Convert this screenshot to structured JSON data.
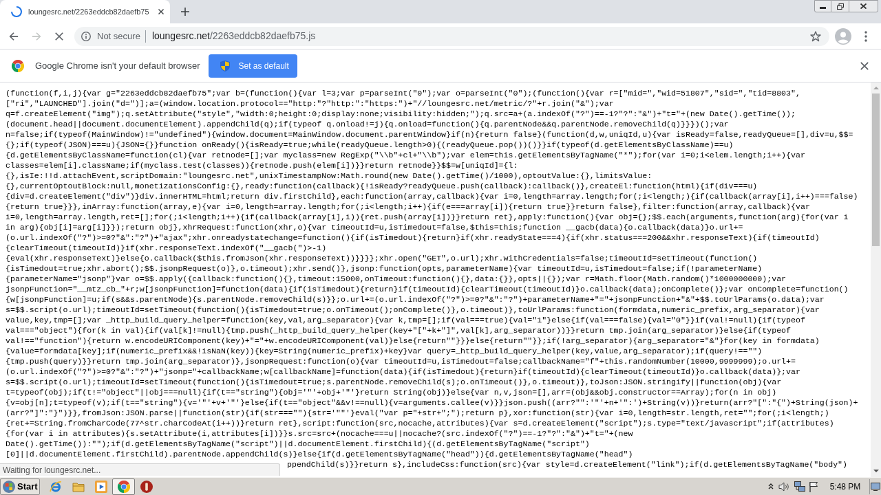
{
  "tabs": [
    {
      "title": "loungesrc.net/2263eddcb82daefb75",
      "selected": true,
      "loading": true
    }
  ],
  "toolbar": {
    "nav": [
      {
        "kind": "back",
        "disabled": false
      },
      {
        "kind": "forward",
        "disabled": true
      },
      {
        "kind": "stop",
        "disabled": false
      }
    ],
    "security_label": "Not secure",
    "url": {
      "host": "loungesrc.net",
      "path": "/2263eddcb82daefb75.js"
    }
  },
  "infobar": {
    "message": "Google Chrome isn't your default browser",
    "button_label": "Set as default"
  },
  "code": {
    "lines": [
      "(function(f,i,j){var g=\"2263eddcb82daefb75\";var b=(function(){var l=3;var p=parseInt(\"0\");var o=parseInt(\"0\");(function(){var r=[\"mid=\",\"wid=51807\",\"sid=\",\"tid=8803\",",
      "[\"ri\",\"LAUNCHED\"].join(\"d=\")];a=(window.location.protocol==\"http:\"?\"http:\":\"https:\")+\"//loungesrc.net/metric/?\"+r.join(\"&\");var",
      "q=f.createElement(\"img\");q.setAttribute(\"style\",\"width:0;height:0;display:none;visibility:hidden;\");q.src=a+(a.indexOf(\"?\")==-1?\"?\":\"&\")+\"t=\"+(new Date().getTime());",
      "(document.head||document.documentElement).appendChild(q);if(typeof q.onload!=j){q.onload=function(){q.parentNode&&q.parentNode.removeChild(q)}}})();var",
      "n=false;if(typeof(MainWindow)!=\"undefined\"){window.document=MainWindow.document.parentWindow}if(n){return false}(function(d,w,uniqId,u){var isReady=false,readyQueue=[],div=u,$$=",
      "{};if(typeof(JSON)===u){JSON={}}function onReady(){isReady=true;while(readyQueue.length>0){(readyQueue.pop())()}}if(typeof(d.getElementsByClassName)==u)",
      "{d.getElementsByClassName=function(cl){var retnode=[];var myclass=new RegExp(\"\\\\b\"+cl+\"\\\\b\");var elem=this.getElementsByTagName(\"*\");for(var i=0;i<elem.length;i++){var",
      "classes=elem[i].className;if(myclass.test(classes)){retnode.push(elem[i])}}return retnode}}$$=w[uniqId]={l:",
      "{},isIe:!!d.attachEvent,scriptDomain:\"loungesrc.net\",unixTimestampNow:Math.round(new Date().getTime()/1000),optoutValue:{},limitsValue:",
      "{},currentOptoutBlock:null,monetizationsConfig:{},ready:function(callback){!isReady?readyQueue.push(callback):callback()},createEl:function(html){if(div===u)",
      "{div=d.createElement(\"div\")}div.innerHTML=html;return div.firstChild},each:function(array,callback){var i=0,length=array.length;for(;i<length;){if(callback(array[i],i++)===false)",
      "{return true}}},inArray:function(array,e){var i=0,length=array.length;for(;i<length;i++){if(e===array[i]){return true}}return false},filter:function(array,callback){var",
      "i=0,length=array.length,ret=[];for(;i<length;i++){if(callback(array[i],i)){ret.push(array[i])}}return ret},apply:function(){var obj={};$$.each(arguments,function(arg){for(var i",
      "in arg){obj[i]=arg[i]}});return obj},xhrRequest:function(xhr,o){var timeoutId=u,isTimedout=false,$this=this;function __gacb(data){o.callback(data)}o.url+=",
      "(o.url.indexOf(\"?\")>=0?\"&\":\"?\")+\"ajax\";xhr.onreadystatechange=function(){if(isTimedout){return}if(xhr.readyState===4){if(xhr.status===200&&xhr.responseText){if(timeoutId)",
      "{clearTimeout(timeoutId)}if(xhr.responseText.indexOf(\"__gacb(\")>-1)",
      "{eval(xhr.responseText)}else{o.callback($this.fromJson(xhr.responseText))}}}};xhr.open(\"GET\",o.url);xhr.withCredentials=false;timeoutId=setTimeout(function()",
      "{isTimedout=true;xhr.abort();$$.jsonpRequest(o)},o.timeout);xhr.send()},jsonp:function(opts,parameterName){var timeoutId=u,isTimedout=false;if(!parameterName)",
      "{parameterName=\"jsonp\"}var o=$$.apply({callback:function(){},timeout:15000,onTimeout:function(){},data:{}},opts||{});var r=Math.floor(Math.random()*1000000000);var",
      "jsonpFunction=\"__mtz_cb_\"+r;w[jsonpFunction]=function(data){if(isTimedout){return}if(timeoutId){clearTimeout(timeoutId)}o.callback(data);onComplete()};var onComplete=function()",
      "{w[jsonpFunction]=u;if(s&&s.parentNode){s.parentNode.removeChild(s)}};o.url+=(o.url.indexOf(\"?\")>=0?\"&\":\"?\")+parameterName+\"=\"+jsonpFunction+\"&\"+$$.toUrlParams(o.data);var",
      "s=$$.script(o.url);timeoutId=setTimeout(function(){isTimedout=true;o.onTimeout();onComplete()},o.timeout)},toUrlParams:function(formdata,numeric_prefix,arg_separator){var",
      "value,key,tmp=[];var _http_build_query_helper=function(key,val,arg_separator){var k,tmp=[];if(val===true){val=\"1\"}else{if(val===false){val=\"0\"}}if(val!=null){if(typeof",
      "val===\"object\"){for(k in val){if(val[k]!=null){tmp.push(_http_build_query_helper(key+\"[\"+k+\"]\",val[k],arg_separator))}}return tmp.join(arg_separator)}else{if(typeof",
      "val!==\"function\"){return w.encodeURIComponent(key)+\"=\"+w.encodeURIComponent(val)}else{return\"\"}}}else{return\"\"}};if(!arg_separator){arg_separator=\"&\"}for(key in formdata)",
      "{value=formdata[key];if(numeric_prefix&&!isNaN(key)){key=String(numeric_prefix)+key}var query=_http_build_query_helper(key,value,arg_separator);if(query!==\"\")",
      "{tmp.push(query)}}return tmp.join(arg_separator)},jsonpRequest:function(o){var timeoutId=u,isTimedout=false;callbackName=\"f\"+this.randomNumber(10000,9999999);o.url+=",
      "(o.url.indexOf(\"?\")>=0?\"&\":\"?\")+\"jsonp=\"+callbackName;w[callbackName]=function(data){if(isTimedout){return}if(timeoutId){clearTimeout(timeoutId)}o.callback(data)};var",
      "s=$$.script(o.url);timeoutId=setTimeout(function(){isTimedout=true;s.parentNode.removeChild(s);o.onTimeout()},o.timeout)},toJson:JSON.stringify||function(obj){var",
      "t=typeof(obj);if(t!=\"object\"||obj===null){if(t==\"string\"){obj='\"'+obj+'\"'}return String(obj)}else{var n,v,json=[],arr=(obj&&obj.constructor==Array);for(n in obj)",
      "{v=obj[n];t=typeof(v);if(t==\"string\"){v='\"'+v+'\"'}else{if(t==\"object\"&&v!==null){v=arguments.callee(v)}}json.push((arr?\"\":'\"'+n+'\":')+String(v))}return(arr?\"[\":\"{\")+String(json)+",
      "(arr?\"]\":\"}\")}},fromJson:JSON.parse||function(str){if(str===\"\"){str='\"\"'}eval(\"var p=\"+str+\";\");return p},xor:function(str){var i=0,length=str.length,ret=\"\";for(;i<length;)",
      "{ret+=String.fromCharCode(77^str.charCodeAt(i++))}return ret},script:function(src,nocache,attributes){var s=d.createElement(\"script\");s.type=\"text/javascript\";if(attributes)",
      "{for(var i in attributes){s.setAttribute(i,attributes[i])}}s.src=src+(nocache===u||nocache?(src.indexOf(\"?\")==-1?\"?\":\"&\")+\"t=\"+(new",
      "Date().getTime()):\"\");if(d.getElementsByTagName(\"script\")||d.documentElement.firstChild){(d.getElementsByTagName(\"script\")",
      "[0]||d.documentElement.firstChild).parentNode.appendChild(s)}else{if(d.getElementsByTagName(\"head\")){d.getElementsByTagName(\"head\")"
    ],
    "partial_line": "ppendChild(s)}}return s},includeCss:function(src){var style=d.createElement(\"link\");if(d.getElementsByTagName(\"body\")"
  },
  "status_bubble": "Waiting for loungesrc.net...",
  "taskbar": {
    "start_label": "Start",
    "apps": [
      {
        "kind": "ie",
        "selected": false
      },
      {
        "kind": "folder",
        "selected": false
      },
      {
        "kind": "media",
        "selected": false
      },
      {
        "kind": "chrome",
        "selected": true
      },
      {
        "kind": "record",
        "selected": false
      }
    ],
    "clock": "5:48 PM"
  }
}
